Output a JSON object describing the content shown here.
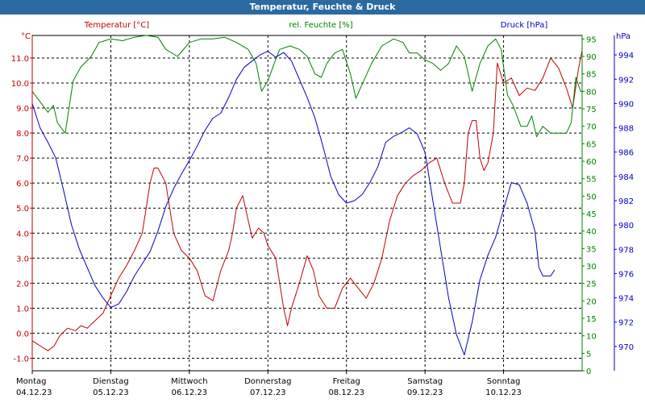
{
  "window": {
    "title": "Temperatur, Feuchte & Druck"
  },
  "colors": {
    "temperature": "#c00000",
    "humidity": "#008000",
    "pressure": "#0000c0",
    "grid": "#000000",
    "titlebar": "#2a6aa0"
  },
  "chart_data": {
    "type": "line",
    "title": "Temperatur, Feuchte & Druck",
    "grid": true,
    "axes": {
      "temperature": {
        "label": "Temperatur [°C]",
        "unit": "°C",
        "range": [
          -1.5,
          11.9
        ],
        "ticks": [
          "-1.0",
          "0.0",
          "1.0",
          "2.0",
          "3.0",
          "4.0",
          "5.0",
          "6.0",
          "7.0",
          "8.0",
          "9.0",
          "10.0",
          "11.0"
        ]
      },
      "humidity": {
        "label": "rel. Feuchte [%]",
        "unit": "%",
        "range": [
          0,
          96
        ],
        "ticks": [
          "0",
          "5",
          "10",
          "15",
          "20",
          "25",
          "30",
          "35",
          "40",
          "45",
          "50",
          "55",
          "60",
          "65",
          "70",
          "75",
          "80",
          "85",
          "90",
          "95"
        ]
      },
      "pressure": {
        "label": "Druck [hPa]",
        "unit": "hPa",
        "range": [
          968,
          995.6
        ],
        "ticks": [
          "970",
          "972",
          "974",
          "976",
          "978",
          "980",
          "982",
          "984",
          "986",
          "988",
          "990",
          "992",
          "994"
        ]
      }
    },
    "x_categories": [
      {
        "day": "Montag",
        "date": "04.12.23"
      },
      {
        "day": "Dienstag",
        "date": "05.12.23"
      },
      {
        "day": "Mittwoch",
        "date": "06.12.23"
      },
      {
        "day": "Donnerstag",
        "date": "07.12.23"
      },
      {
        "day": "Freitag",
        "date": "08.12.23"
      },
      {
        "day": "Samstag",
        "date": "09.12.23"
      },
      {
        "day": "Sonntag",
        "date": "10.12.23"
      }
    ],
    "x_range": [
      0,
      7
    ],
    "series": [
      {
        "name": "Temperatur [°C]",
        "axis": "temperature",
        "color": "#c00000",
        "points": [
          [
            0,
            -0.3
          ],
          [
            0.05,
            -0.4
          ],
          [
            0.1,
            -0.5
          ],
          [
            0.2,
            -0.7
          ],
          [
            0.28,
            -0.5
          ],
          [
            0.35,
            -0.1
          ],
          [
            0.45,
            0.2
          ],
          [
            0.55,
            0.1
          ],
          [
            0.62,
            0.3
          ],
          [
            0.7,
            0.2
          ],
          [
            0.8,
            0.5
          ],
          [
            0.9,
            0.8
          ],
          [
            1.0,
            1.5
          ],
          [
            1.1,
            2.2
          ],
          [
            1.2,
            2.7
          ],
          [
            1.3,
            3.3
          ],
          [
            1.4,
            4.0
          ],
          [
            1.45,
            5.0
          ],
          [
            1.5,
            6.0
          ],
          [
            1.55,
            6.6
          ],
          [
            1.6,
            6.6
          ],
          [
            1.7,
            6.0
          ],
          [
            1.8,
            4.0
          ],
          [
            1.9,
            3.3
          ],
          [
            2.0,
            3.0
          ],
          [
            2.1,
            2.5
          ],
          [
            2.2,
            1.5
          ],
          [
            2.3,
            1.3
          ],
          [
            2.4,
            2.5
          ],
          [
            2.5,
            3.3
          ],
          [
            2.55,
            4.0
          ],
          [
            2.6,
            5.0
          ],
          [
            2.68,
            5.5
          ],
          [
            2.75,
            4.5
          ],
          [
            2.8,
            3.8
          ],
          [
            2.88,
            4.2
          ],
          [
            2.95,
            4.0
          ],
          [
            3.0,
            3.5
          ],
          [
            3.1,
            3.0
          ],
          [
            3.15,
            2.0
          ],
          [
            3.2,
            1.0
          ],
          [
            3.25,
            0.3
          ],
          [
            3.3,
            1.0
          ],
          [
            3.4,
            2.0
          ],
          [
            3.5,
            3.1
          ],
          [
            3.58,
            2.5
          ],
          [
            3.65,
            1.5
          ],
          [
            3.75,
            1.0
          ],
          [
            3.85,
            1.0
          ],
          [
            3.95,
            1.8
          ],
          [
            4.05,
            2.2
          ],
          [
            4.15,
            1.8
          ],
          [
            4.25,
            1.4
          ],
          [
            4.35,
            2.0
          ],
          [
            4.45,
            3.0
          ],
          [
            4.55,
            4.5
          ],
          [
            4.65,
            5.5
          ],
          [
            4.75,
            6.0
          ],
          [
            4.85,
            6.3
          ],
          [
            4.95,
            6.5
          ],
          [
            5.05,
            6.8
          ],
          [
            5.15,
            7.0
          ],
          [
            5.25,
            6.0
          ],
          [
            5.35,
            5.2
          ],
          [
            5.45,
            5.2
          ],
          [
            5.5,
            6.0
          ],
          [
            5.55,
            8.0
          ],
          [
            5.6,
            8.5
          ],
          [
            5.65,
            8.5
          ],
          [
            5.7,
            7.0
          ],
          [
            5.75,
            6.5
          ],
          [
            5.8,
            6.8
          ],
          [
            5.87,
            8.0
          ],
          [
            5.92,
            10.8
          ],
          [
            6.0,
            10.0
          ],
          [
            6.1,
            10.2
          ],
          [
            6.2,
            9.5
          ],
          [
            6.3,
            9.8
          ],
          [
            6.4,
            9.7
          ],
          [
            6.5,
            10.2
          ],
          [
            6.6,
            11.0
          ],
          [
            6.7,
            10.6
          ],
          [
            6.8,
            9.8
          ],
          [
            6.88,
            9.0
          ],
          [
            6.95,
            10.5
          ],
          [
            7.0,
            11.3
          ]
        ]
      },
      {
        "name": "rel. Feuchte [%]",
        "axis": "humidity",
        "color": "#008000",
        "points": [
          [
            0,
            80
          ],
          [
            0.1,
            77
          ],
          [
            0.2,
            74
          ],
          [
            0.27,
            76
          ],
          [
            0.32,
            71
          ],
          [
            0.42,
            68
          ],
          [
            0.52,
            83
          ],
          [
            0.62,
            87
          ],
          [
            0.75,
            90
          ],
          [
            0.85,
            94
          ],
          [
            1.0,
            95
          ],
          [
            1.15,
            94.5
          ],
          [
            1.3,
            95.5
          ],
          [
            1.45,
            96
          ],
          [
            1.6,
            95.5
          ],
          [
            1.7,
            92
          ],
          [
            1.85,
            90
          ],
          [
            2.0,
            94
          ],
          [
            2.15,
            95
          ],
          [
            2.3,
            95
          ],
          [
            2.45,
            95.5
          ],
          [
            2.6,
            94
          ],
          [
            2.75,
            92
          ],
          [
            2.85,
            88
          ],
          [
            2.92,
            80
          ],
          [
            3.0,
            83
          ],
          [
            3.08,
            88
          ],
          [
            3.15,
            92
          ],
          [
            3.28,
            93
          ],
          [
            3.4,
            92
          ],
          [
            3.5,
            90
          ],
          [
            3.6,
            85
          ],
          [
            3.68,
            84
          ],
          [
            3.75,
            88
          ],
          [
            3.85,
            91
          ],
          [
            3.95,
            92
          ],
          [
            4.05,
            85
          ],
          [
            4.12,
            78
          ],
          [
            4.22,
            83
          ],
          [
            4.32,
            88
          ],
          [
            4.45,
            93
          ],
          [
            4.6,
            95
          ],
          [
            4.72,
            94
          ],
          [
            4.8,
            91
          ],
          [
            4.9,
            91
          ],
          [
            5.0,
            89
          ],
          [
            5.1,
            88
          ],
          [
            5.2,
            86
          ],
          [
            5.3,
            88
          ],
          [
            5.4,
            93
          ],
          [
            5.5,
            90
          ],
          [
            5.6,
            80
          ],
          [
            5.7,
            88
          ],
          [
            5.8,
            93
          ],
          [
            5.9,
            95
          ],
          [
            5.97,
            92
          ],
          [
            6.05,
            79
          ],
          [
            6.12,
            76
          ],
          [
            6.22,
            70
          ],
          [
            6.3,
            70
          ],
          [
            6.36,
            73
          ],
          [
            6.42,
            67
          ],
          [
            6.5,
            70
          ],
          [
            6.6,
            68
          ],
          [
            6.7,
            68
          ],
          [
            6.8,
            68
          ],
          [
            6.86,
            71
          ],
          [
            6.92,
            84
          ],
          [
            6.98,
            80
          ],
          [
            7.0,
            80
          ]
        ]
      },
      {
        "name": "Druck [hPa]",
        "axis": "pressure",
        "color": "#0000c0",
        "points": [
          [
            0,
            990
          ],
          [
            0.1,
            988
          ],
          [
            0.2,
            986.8
          ],
          [
            0.3,
            985.5
          ],
          [
            0.4,
            982.8
          ],
          [
            0.5,
            980
          ],
          [
            0.6,
            978
          ],
          [
            0.7,
            976.5
          ],
          [
            0.8,
            975
          ],
          [
            0.9,
            974
          ],
          [
            1.0,
            973.2
          ],
          [
            1.1,
            973.5
          ],
          [
            1.2,
            974.5
          ],
          [
            1.3,
            975.8
          ],
          [
            1.4,
            976.8
          ],
          [
            1.5,
            977.8
          ],
          [
            1.6,
            979.5
          ],
          [
            1.7,
            981.5
          ],
          [
            1.8,
            983
          ],
          [
            1.9,
            984.2
          ],
          [
            2.0,
            985.3
          ],
          [
            2.1,
            986.5
          ],
          [
            2.2,
            987.8
          ],
          [
            2.3,
            988.8
          ],
          [
            2.4,
            989.2
          ],
          [
            2.5,
            990.5
          ],
          [
            2.6,
            992
          ],
          [
            2.7,
            993
          ],
          [
            2.8,
            993.5
          ],
          [
            2.9,
            994
          ],
          [
            3.0,
            994.3
          ],
          [
            3.1,
            993.8
          ],
          [
            3.2,
            994.2
          ],
          [
            3.3,
            993.5
          ],
          [
            3.4,
            992
          ],
          [
            3.5,
            990.5
          ],
          [
            3.6,
            988.8
          ],
          [
            3.7,
            986.5
          ],
          [
            3.8,
            984
          ],
          [
            3.9,
            982.5
          ],
          [
            4.0,
            981.8
          ],
          [
            4.1,
            982
          ],
          [
            4.2,
            982.5
          ],
          [
            4.3,
            983.5
          ],
          [
            4.4,
            984.8
          ],
          [
            4.5,
            986.8
          ],
          [
            4.6,
            987.3
          ],
          [
            4.7,
            987.6
          ],
          [
            4.8,
            988
          ],
          [
            4.9,
            987.5
          ],
          [
            5.0,
            986
          ],
          [
            5.1,
            982
          ],
          [
            5.2,
            978
          ],
          [
            5.3,
            974
          ],
          [
            5.4,
            971
          ],
          [
            5.5,
            969.3
          ],
          [
            5.6,
            972
          ],
          [
            5.7,
            975.5
          ],
          [
            5.8,
            977.5
          ],
          [
            5.9,
            979
          ],
          [
            6.0,
            981.3
          ],
          [
            6.1,
            983.5
          ],
          [
            6.2,
            983.3
          ],
          [
            6.3,
            981.8
          ],
          [
            6.4,
            979.5
          ],
          [
            6.45,
            976.5
          ],
          [
            6.5,
            975.8
          ],
          [
            6.6,
            975.8
          ],
          [
            6.65,
            976.3
          ]
        ]
      }
    ]
  }
}
